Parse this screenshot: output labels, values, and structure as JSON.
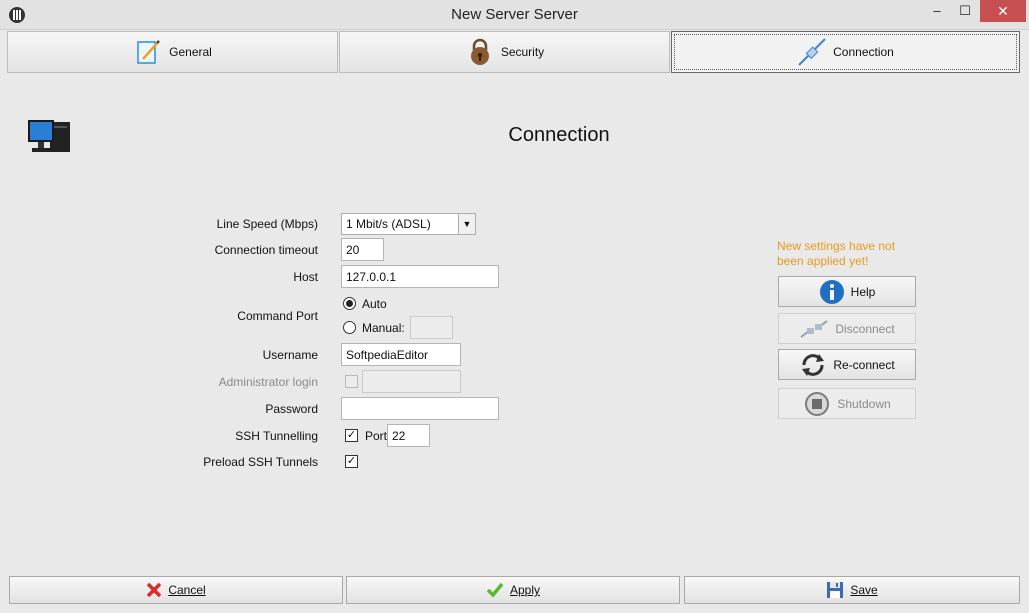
{
  "window": {
    "title": "New Server Server",
    "min": "–",
    "max": "☐",
    "close": "✕"
  },
  "tabs": [
    {
      "label": "General",
      "icon": "pencil-paper-icon"
    },
    {
      "label": "Security",
      "icon": "padlock-icon"
    },
    {
      "label": "Connection",
      "icon": "plug-cable-icon",
      "active": true
    }
  ],
  "page": {
    "title": "Connection",
    "icon": "computer-icon"
  },
  "form": {
    "line_speed": {
      "label": "Line Speed (Mbps)",
      "value": "1 Mbit/s (ADSL)"
    },
    "timeout": {
      "label": "Connection timeout",
      "value": "20"
    },
    "host": {
      "label": "Host",
      "value": "127.0.0.1"
    },
    "command_port": {
      "label": "Command Port",
      "auto_label": "Auto",
      "manual_label": "Manual:",
      "selected": "Auto",
      "manual_value": ""
    },
    "username": {
      "label": "Username",
      "value": "SoftpediaEditor"
    },
    "admin_login": {
      "label": "Administrator login",
      "checked": false,
      "value": ""
    },
    "password": {
      "label": "Password",
      "value": ""
    },
    "ssh_tunnelling": {
      "label": "SSH Tunnelling",
      "checked": true,
      "port_label": "Port",
      "port_value": "22"
    },
    "preload_ssh": {
      "label": "Preload SSH Tunnels",
      "checked": true
    }
  },
  "side": {
    "notice": "New settings have not been applied yet!",
    "help": "Help",
    "disconnect": "Disconnect",
    "reconnect": "Re-connect",
    "shutdown": "Shutdown"
  },
  "footer": {
    "cancel_label": "Cancel",
    "apply_label": "Apply",
    "save_label": "Save"
  },
  "colors": {
    "notice": "#e89a22",
    "cancel_icon": "#d62d2d",
    "apply_icon": "#5cb82e",
    "help_icon": "#1f6fc4"
  }
}
